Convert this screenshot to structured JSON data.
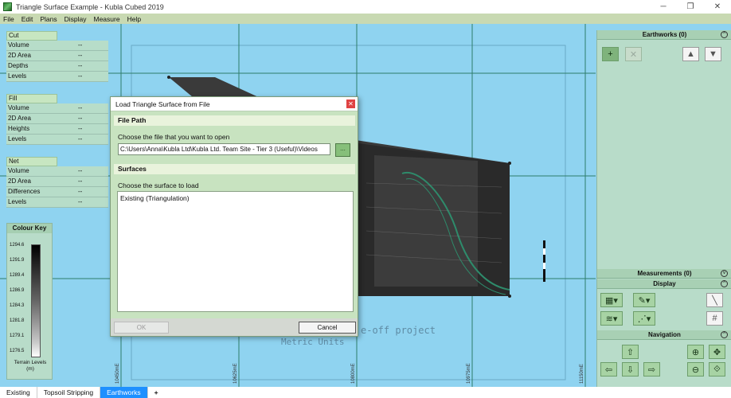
{
  "window": {
    "title": "Triangle Surface Example - Kubla Cubed 2019"
  },
  "menu": [
    "File",
    "Edit",
    "Plans",
    "Display",
    "Measure",
    "Help"
  ],
  "cut": {
    "header": "Cut",
    "rows": [
      {
        "label": "Volume",
        "value": "--"
      },
      {
        "label": "2D Area",
        "value": "--"
      },
      {
        "label": "Depths",
        "value": "--"
      },
      {
        "label": "Levels",
        "value": "--"
      }
    ]
  },
  "fill": {
    "header": "Fill",
    "rows": [
      {
        "label": "Volume",
        "value": "--"
      },
      {
        "label": "2D Area",
        "value": "--"
      },
      {
        "label": "Heights",
        "value": "--"
      },
      {
        "label": "Levels",
        "value": "--"
      }
    ]
  },
  "net": {
    "header": "Net",
    "rows": [
      {
        "label": "Volume",
        "value": "--"
      },
      {
        "label": "2D Area",
        "value": "--"
      },
      {
        "label": "Differences",
        "value": "--"
      },
      {
        "label": "Levels",
        "value": "--"
      }
    ]
  },
  "colour_key": {
    "title": "Colour Key",
    "ticks": [
      "1294.6",
      "1291.9",
      "1289.4",
      "1286.9",
      "1284.3",
      "1281.8",
      "1279.1",
      "1276.5"
    ],
    "footer_line1": "Terrain Levels",
    "footer_line2": "(m)"
  },
  "canvas": {
    "axis_labels": [
      "10450mE",
      "10625mE",
      "10800mE",
      "10975mE",
      "11150mE"
    ],
    "watermark_line1": "e-off project",
    "watermark_line2": "Metric Units"
  },
  "right_panel": {
    "earthworks_header": "Earthworks (0)",
    "measurements_header": "Measurements (0)",
    "display_header": "Display",
    "navigation_header": "Navigation"
  },
  "dialog": {
    "title": "Load Triangle Surface from File",
    "file_path_header": "File Path",
    "file_prompt": "Choose the file that you want to open",
    "file_path_value": "C:\\Users\\Anna\\Kubla Ltd\\Kubla Ltd. Team Site - Tier 3 (Useful)\\Videos",
    "browse_label": "...",
    "surfaces_header": "Surfaces",
    "surface_prompt": "Choose the surface to load",
    "surfaces": [
      "Existing (Triangulation)"
    ],
    "ok_label": "OK",
    "cancel_label": "Cancel"
  },
  "tabs": [
    "Existing",
    "Topsoil Stripping",
    "Earthworks",
    "+"
  ],
  "active_tab": "Earthworks",
  "colors": {
    "canvas_bg": "#8fd3f0",
    "panel_bg": "#b8dcc9",
    "accent": "#1e90ff",
    "close_btn": "#e04343"
  }
}
